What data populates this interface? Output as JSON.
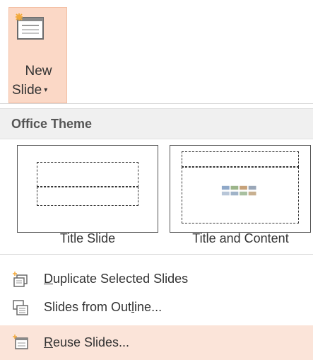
{
  "ribbon": {
    "new_slide_line1": "New",
    "new_slide_line2": "Slide",
    "caret": "▾",
    "icon": "new-slide-icon"
  },
  "gallery": {
    "section_title": "Office Theme",
    "layouts": [
      {
        "label": "Title Slide",
        "icon": "title-slide-layout-icon"
      },
      {
        "label": "Title and Content",
        "icon": "title-content-layout-icon"
      }
    ]
  },
  "menu": {
    "items": [
      {
        "prefix": "",
        "accel": "D",
        "rest": "uplicate Selected Slides",
        "icon": "duplicate-slides-icon"
      },
      {
        "prefix": "Slides from Out",
        "accel": "l",
        "rest": "ine...",
        "icon": "slides-from-outline-icon"
      },
      {
        "prefix": "",
        "accel": "R",
        "rest": "euse Slides...",
        "icon": "reuse-slides-icon"
      }
    ]
  },
  "colors": {
    "button_hover": "#fbd8c6",
    "item_hover": "#fbe4d9",
    "header_bg": "#f0f0f0",
    "icon_accent": "#f2a93b"
  }
}
